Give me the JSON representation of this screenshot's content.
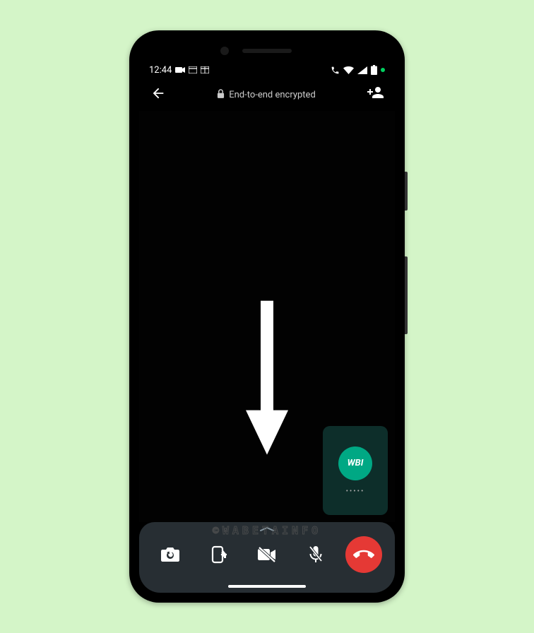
{
  "statusBar": {
    "time": "12:44",
    "icons": {
      "video": "video-icon",
      "window1": "window-icon",
      "window2": "calendar-icon",
      "phone": "phone-active-icon",
      "wifi": "wifi-icon",
      "signal": "signal-icon",
      "battery": "battery-icon",
      "dot": "notification-dot"
    }
  },
  "topBar": {
    "encryptionLabel": "End-to-end encrypted"
  },
  "pip": {
    "avatarText": "WBI",
    "dots": "•••••"
  },
  "watermark": "©WABETAINFO",
  "colors": {
    "background": "#d4f5c8",
    "sheet": "#272e33",
    "accent": "#00a884",
    "endCall": "#e53935"
  },
  "controls": {
    "switchCamera": "switch-camera",
    "screenShare": "screen-share",
    "videoOff": "video-off",
    "micOff": "mic-off",
    "endCall": "end-call"
  }
}
